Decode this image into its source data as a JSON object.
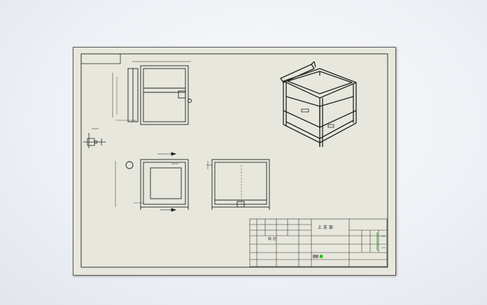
{
  "window": {
    "background_top": "#fbfcfd",
    "background_bottom": "#e2e6ec"
  },
  "sheet": {
    "paper_color": "#e7e7dd",
    "line_color": "#1a1a1a"
  },
  "title_block": {
    "part_title": "上 支 架",
    "material_label": "标 记",
    "highlight_color": "#20c020"
  },
  "views": [
    {
      "name": "top-view"
    },
    {
      "name": "section-detail"
    },
    {
      "name": "front-view"
    },
    {
      "name": "side-view"
    },
    {
      "name": "isometric-view"
    }
  ]
}
